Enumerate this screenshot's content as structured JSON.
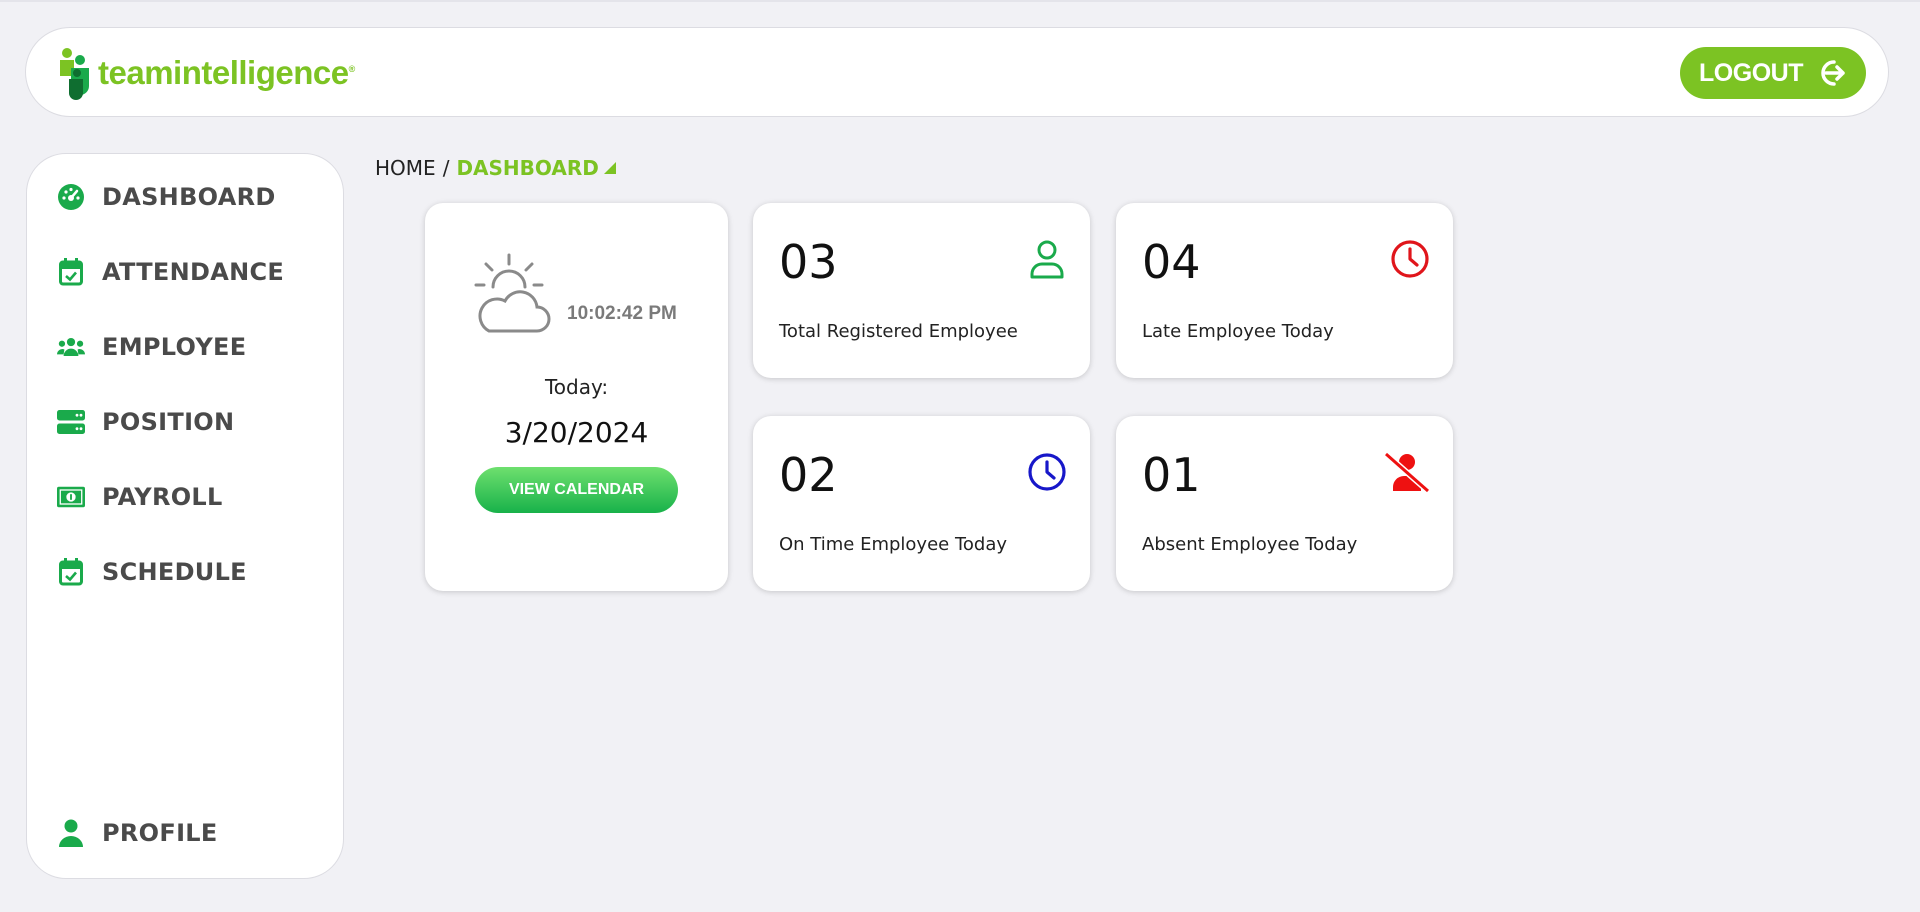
{
  "brand": {
    "name": "teamintelligence",
    "trademark": "®",
    "accent": "#7cc323",
    "icon_accent": "#1aaa4b"
  },
  "header": {
    "logout_label": "LOGOUT"
  },
  "sidebar": {
    "items": [
      {
        "label": "DASHBOARD",
        "icon": "dashboard-gauge-icon"
      },
      {
        "label": "ATTENDANCE",
        "icon": "calendar-check-icon"
      },
      {
        "label": "EMPLOYEE",
        "icon": "users-icon"
      },
      {
        "label": "POSITION",
        "icon": "server-icon"
      },
      {
        "label": "PAYROLL",
        "icon": "money-bill-icon"
      },
      {
        "label": "SCHEDULE",
        "icon": "calendar-check-icon"
      }
    ],
    "profile": {
      "label": "PROFILE",
      "icon": "user-icon"
    }
  },
  "breadcrumb": {
    "home": "HOME",
    "separator": "/",
    "current": "DASHBOARD"
  },
  "clock_card": {
    "time": "10:02:42 PM",
    "today_label": "Today:",
    "date": "3/20/2024",
    "button_label": "VIEW CALENDAR",
    "weather_icon": "sun-behind-cloud-icon"
  },
  "stats": [
    {
      "value": "03",
      "label": "Total Registered Employee",
      "icon": "user-outline-icon",
      "color": "#1aaa4b"
    },
    {
      "value": "04",
      "label": "Late Employee Today",
      "icon": "clock-icon",
      "color": "#e0151b"
    },
    {
      "value": "02",
      "label": "On Time Employee Today",
      "icon": "clock-icon",
      "color": "#1717c9"
    },
    {
      "value": "01",
      "label": "Absent Employee Today",
      "icon": "user-slash-icon",
      "color": "#ee1111"
    }
  ]
}
